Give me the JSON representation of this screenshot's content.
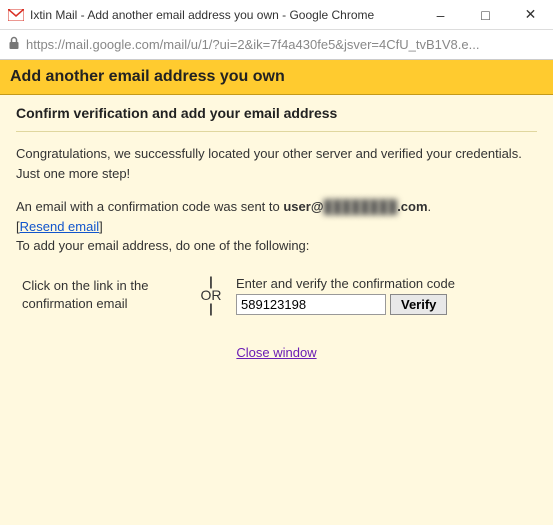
{
  "window": {
    "title": "Ixtin Mail - Add another email address you own - Google Chrome",
    "url": "https://mail.google.com/mail/u/1/?ui=2&ik=7f4a430fe5&jsver=4CfU_tvB1V8.e..."
  },
  "header": {
    "title": "Add another email address you own"
  },
  "sub": {
    "title": "Confirm verification and add your email address"
  },
  "congrats": {
    "line1": "Congratulations, we successfully located your other server and verified your credentials.",
    "line2": "Just one more step!"
  },
  "sent": {
    "prefix": "An email with a confirmation code was sent to ",
    "user": "user@",
    "blur": "████████",
    "domain": ".com",
    "suffix": ".",
    "resend": "Resend email",
    "todo": "To add your email address, do one of the following:"
  },
  "left": {
    "text": "Click on the link in the confirmation email"
  },
  "or": {
    "text": "OR"
  },
  "right": {
    "label": "Enter and verify the confirmation code",
    "value": "589123198",
    "button": "Verify"
  },
  "close": {
    "text": "Close window"
  }
}
